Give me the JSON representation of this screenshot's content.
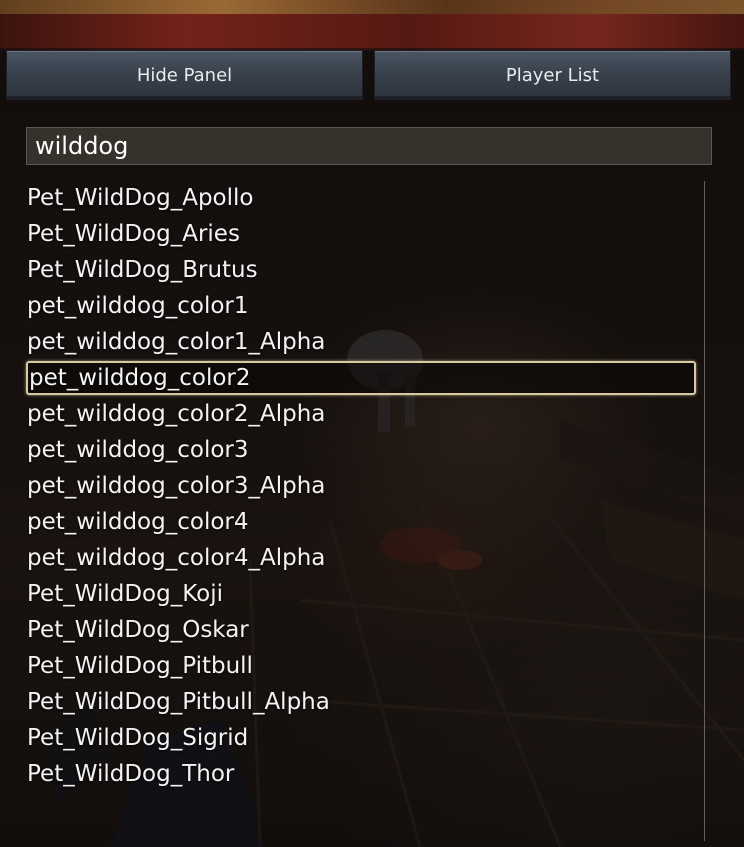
{
  "toolbar": {
    "hide_panel_label": "Hide Panel",
    "player_list_label": "Player List"
  },
  "search": {
    "value": "wilddog"
  },
  "results": {
    "selected_index": 5,
    "items": [
      {
        "label": "Pet_WildDog_Apollo"
      },
      {
        "label": "Pet_WildDog_Aries"
      },
      {
        "label": "Pet_WildDog_Brutus"
      },
      {
        "label": "pet_wilddog_color1"
      },
      {
        "label": "pet_wilddog_color1_Alpha"
      },
      {
        "label": "pet_wilddog_color2"
      },
      {
        "label": "pet_wilddog_color2_Alpha"
      },
      {
        "label": "pet_wilddog_color3"
      },
      {
        "label": "pet_wilddog_color3_Alpha"
      },
      {
        "label": "pet_wilddog_color4"
      },
      {
        "label": "pet_wilddog_color4_Alpha"
      },
      {
        "label": "Pet_WildDog_Koji"
      },
      {
        "label": "Pet_WildDog_Oskar"
      },
      {
        "label": "Pet_WildDog_Pitbull"
      },
      {
        "label": "Pet_WildDog_Pitbull_Alpha"
      },
      {
        "label": "Pet_WildDog_Sigrid"
      },
      {
        "label": "Pet_WildDog_Thor"
      }
    ]
  },
  "colors": {
    "selection_border": "#d8c9a0",
    "button_face": "#39424d",
    "text": "#f4f4f2"
  }
}
